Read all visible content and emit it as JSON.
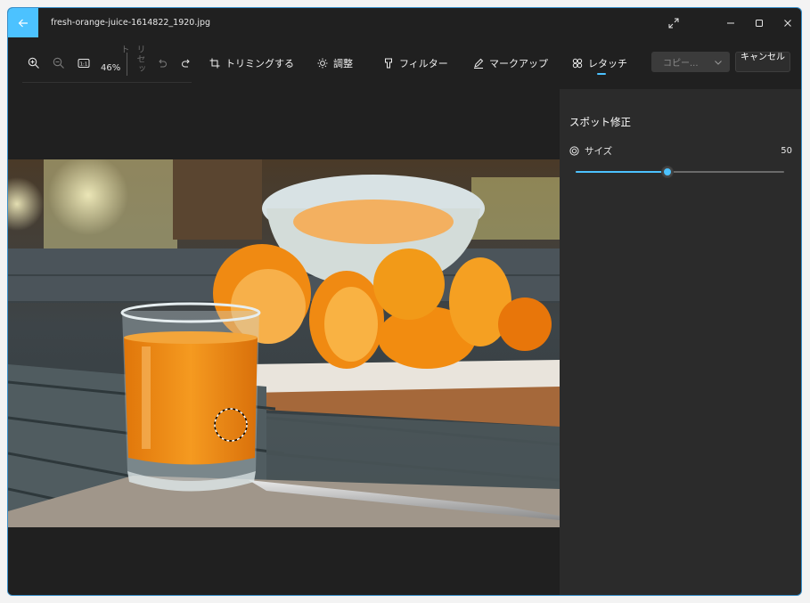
{
  "titlebar": {
    "filename": "fresh-orange-juice-1614822_1920.jpg",
    "back_icon": "back-arrow-icon",
    "expand_icon": "expand-icon",
    "minimize_icon": "minimize-icon",
    "maximize_icon": "maximize-icon",
    "close_icon": "close-icon"
  },
  "toolbar": {
    "zoom_in_icon": "zoom-in-icon",
    "zoom_out_icon": "zoom-out-icon",
    "actual_size_icon": "actual-size-icon",
    "zoom_level": "46%",
    "reset_label": "リセット",
    "undo_icon": "undo-icon",
    "redo_icon": "redo-icon",
    "tools": [
      {
        "label": "トリミングする",
        "icon": "crop-icon"
      },
      {
        "label": "調整",
        "icon": "brightness-icon"
      },
      {
        "label": "フィルター",
        "icon": "filter-icon"
      },
      {
        "label": "マークアップ",
        "icon": "markup-pen-icon"
      },
      {
        "label": "レタッチ",
        "icon": "retouch-icon"
      }
    ],
    "active_tool": "レタッチ",
    "copy_dropdown": "コピー...",
    "cancel_label": "キャンセル"
  },
  "panel": {
    "title": "スポット修正",
    "size_label": "サイズ",
    "size_value": "50",
    "slider_fraction": 0.44
  },
  "colors": {
    "accent": "#4cc2ff",
    "background": "#202020",
    "panel": "#2b2b2b"
  }
}
